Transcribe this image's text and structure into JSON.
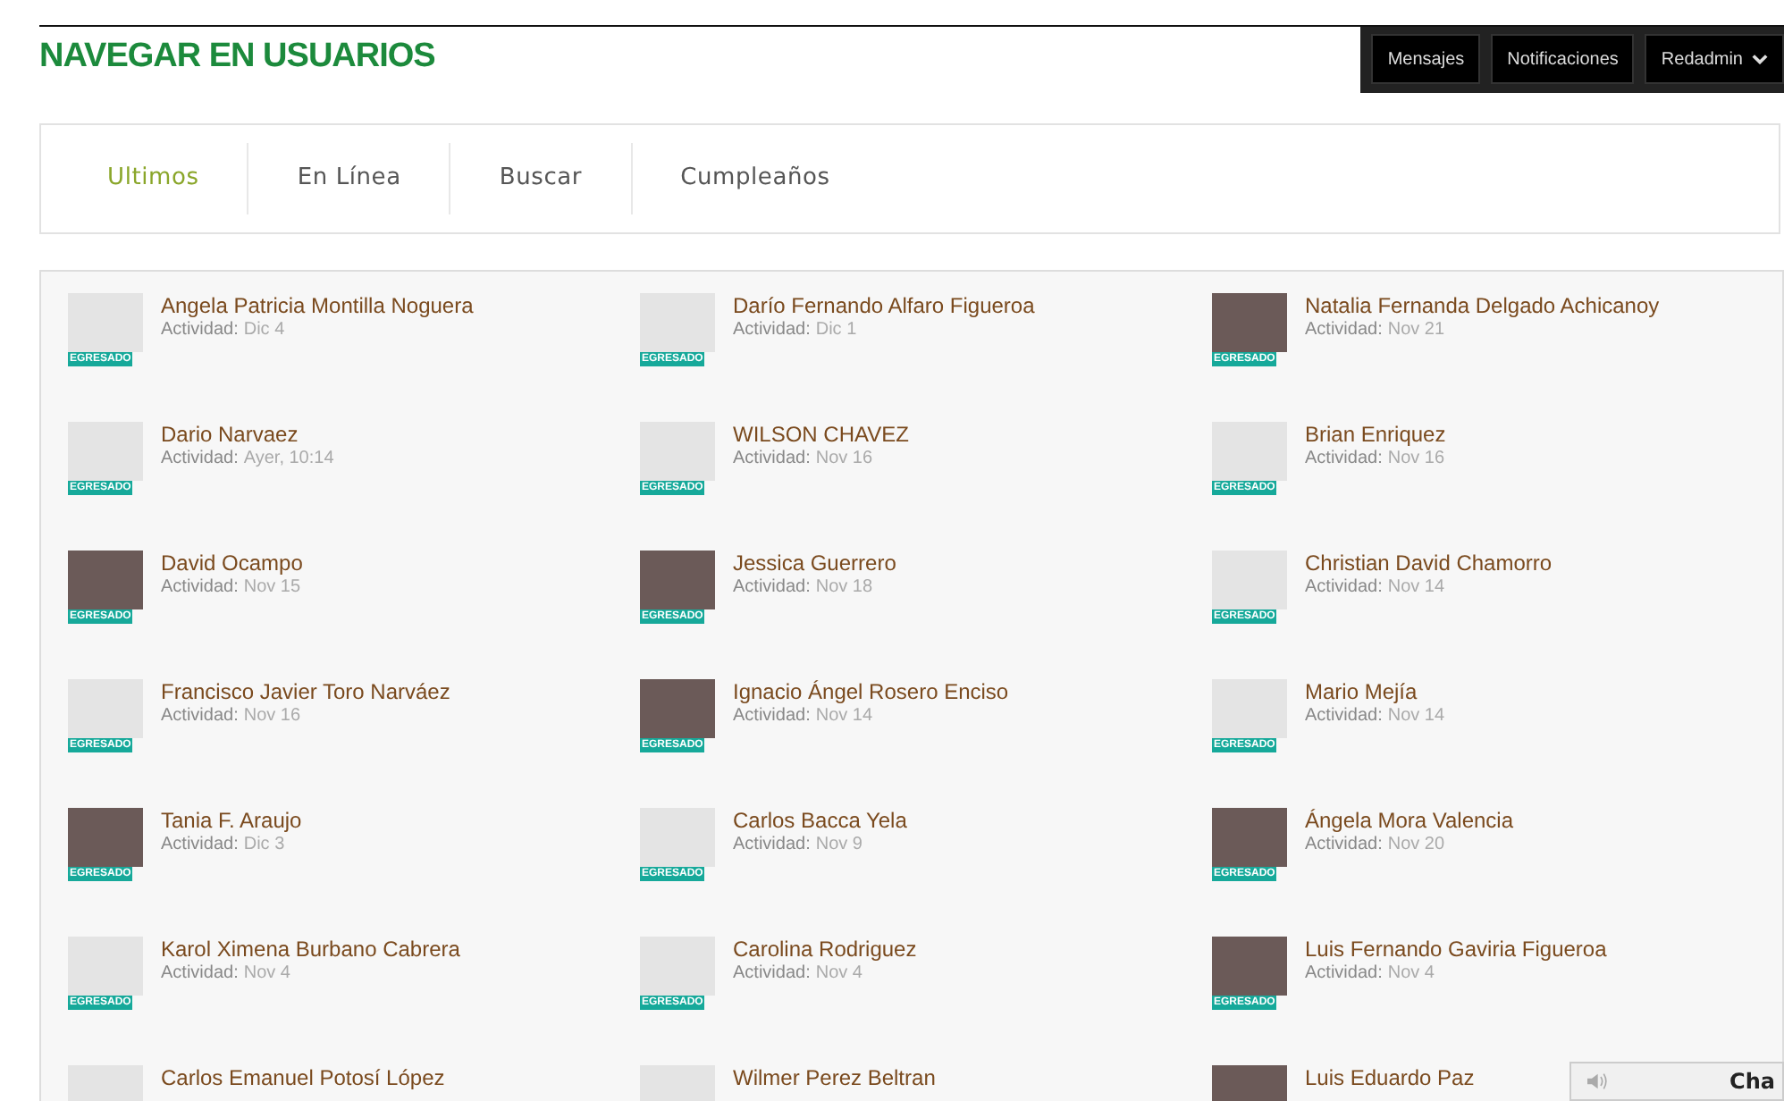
{
  "page": {
    "title": "NAVEGAR EN USUARIOS"
  },
  "top_nav": {
    "items": [
      {
        "label": "Mensajes",
        "kind": "link"
      },
      {
        "label": "Notificaciones",
        "kind": "link"
      },
      {
        "label": "Redadmin",
        "kind": "dropdown"
      }
    ]
  },
  "tabs": [
    {
      "label": "Ultimos",
      "selected": true
    },
    {
      "label": "En Línea",
      "selected": false
    },
    {
      "label": "Buscar",
      "selected": false
    },
    {
      "label": "Cumpleaños",
      "selected": false
    }
  ],
  "users": [
    {
      "name": "Angela Patricia Montilla Noguera",
      "activity_label": "Actividad:",
      "activity": "Dic 4",
      "photo": false,
      "badge": "EGRESADO"
    },
    {
      "name": "Darío Fernando Alfaro Figueroa",
      "activity_label": "Actividad:",
      "activity": "Dic 1",
      "photo": false,
      "badge": "EGRESADO"
    },
    {
      "name": "Natalia Fernanda Delgado Achicanoy",
      "activity_label": "Actividad:",
      "activity": "Nov 21",
      "photo": true,
      "badge": "EGRESADO"
    },
    {
      "name": "Dario Narvaez",
      "activity_label": "Actividad:",
      "activity": "Ayer, 10:14",
      "photo": false,
      "badge": "EGRESADO"
    },
    {
      "name": "WILSON CHAVEZ",
      "activity_label": "Actividad:",
      "activity": "Nov 16",
      "photo": false,
      "badge": "EGRESADO"
    },
    {
      "name": "Brian Enriquez",
      "activity_label": "Actividad:",
      "activity": "Nov 16",
      "photo": false,
      "badge": "EGRESADO"
    },
    {
      "name": "David Ocampo",
      "activity_label": "Actividad:",
      "activity": "Nov 15",
      "photo": true,
      "badge": "EGRESADO"
    },
    {
      "name": "Jessica Guerrero",
      "activity_label": "Actividad:",
      "activity": "Nov 18",
      "photo": true,
      "badge": "EGRESADO"
    },
    {
      "name": "Christian David Chamorro",
      "activity_label": "Actividad:",
      "activity": "Nov 14",
      "photo": false,
      "badge": "EGRESADO"
    },
    {
      "name": "Francisco Javier Toro Narváez",
      "activity_label": "Actividad:",
      "activity": "Nov 16",
      "photo": false,
      "badge": "EGRESADO"
    },
    {
      "name": "Ignacio Ángel Rosero Enciso",
      "activity_label": "Actividad:",
      "activity": "Nov 14",
      "photo": true,
      "badge": "EGRESADO"
    },
    {
      "name": "Mario Mejía",
      "activity_label": "Actividad:",
      "activity": "Nov 14",
      "photo": false,
      "badge": "EGRESADO"
    },
    {
      "name": "Tania F. Araujo",
      "activity_label": "Actividad:",
      "activity": "Dic 3",
      "photo": true,
      "badge": "EGRESADO"
    },
    {
      "name": "Carlos Bacca Yela",
      "activity_label": "Actividad:",
      "activity": "Nov 9",
      "photo": false,
      "badge": "EGRESADO"
    },
    {
      "name": "Ángela Mora Valencia",
      "activity_label": "Actividad:",
      "activity": "Nov 20",
      "photo": true,
      "badge": "EGRESADO"
    },
    {
      "name": "Karol Ximena Burbano Cabrera",
      "activity_label": "Actividad:",
      "activity": "Nov 4",
      "photo": false,
      "badge": "EGRESADO"
    },
    {
      "name": "Carolina Rodriguez",
      "activity_label": "Actividad:",
      "activity": "Nov 4",
      "photo": false,
      "badge": "EGRESADO"
    },
    {
      "name": "Luis Fernando Gaviria Figueroa",
      "activity_label": "Actividad:",
      "activity": "Nov 4",
      "photo": true,
      "badge": "EGRESADO"
    },
    {
      "name": "Carlos Emanuel Potosí López",
      "photo": false
    },
    {
      "name": "Wilmer Perez Beltran",
      "photo": false
    },
    {
      "name": "Luis Eduardo Paz",
      "photo": true
    }
  ],
  "chat_bar": {
    "label": "Cha"
  }
}
